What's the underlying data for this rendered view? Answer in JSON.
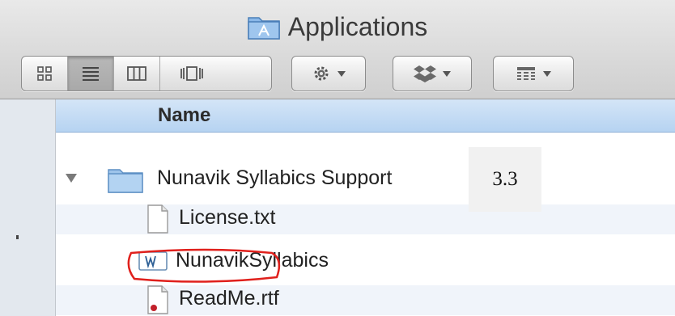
{
  "window": {
    "title": "Applications"
  },
  "toolbar": {
    "view_buttons": [
      "icon-view-icon",
      "list-view-icon",
      "column-view-icon",
      "cover-flow-icon"
    ],
    "active_view": "list-view-icon",
    "action_menu_icon": "gear-icon",
    "dropbox_menu_icon": "dropbox-icon",
    "arrange_menu_icon": "arrange-grid-icon"
  },
  "list": {
    "column_header": "Name",
    "rows": [
      {
        "label": "Nunavik Syllabics Support",
        "icon": "folder-icon",
        "expanded": true
      },
      {
        "label": "License.txt",
        "icon": "text-document-icon"
      },
      {
        "label": "NunavikSyllabics",
        "icon": "font-suitcase-icon"
      },
      {
        "label": "ReadMe.rtf",
        "icon": "rtf-document-icon"
      }
    ]
  },
  "annotation": {
    "step_label": "3.3",
    "highlight_color": "#e0201c"
  },
  "colors": {
    "header_blue": "#b6d3f1",
    "sidebar": "#e3e8ee"
  }
}
